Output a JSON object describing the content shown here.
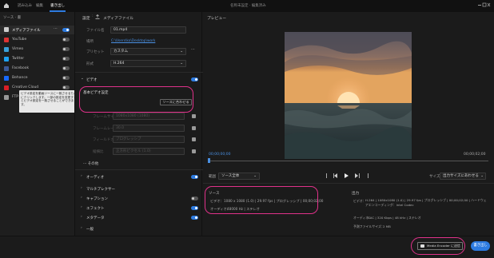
{
  "topbar": {
    "tabs": [
      "読み込み",
      "編集",
      "書き出し"
    ],
    "active_tab": 2,
    "title": "名称未設定 · 編集済み"
  },
  "sidebar": {
    "header": "ソース · 書",
    "items": [
      {
        "label": "メディアファイル",
        "on": true,
        "active": true
      },
      {
        "label": "YouTube",
        "on": false
      },
      {
        "label": "Vimeo",
        "on": false
      },
      {
        "label": "Twitter",
        "on": false
      },
      {
        "label": "Facebook",
        "on": false
      },
      {
        "label": "Behance",
        "on": false
      },
      {
        "label": "Creative Cloud",
        "on": false
      },
      {
        "label": "FTP",
        "on": false
      }
    ],
    "tooltip": "ビデオ設定を動画ソースに一致させるためにクリックします。一部の設定を変更するとビデオ設定を一致させることができます。"
  },
  "settings": {
    "header_left": "設定",
    "header_right": "メディアファイル",
    "filename_label": "ファイル名",
    "filename_value": "01.mp4",
    "location_label": "場所",
    "location_value": "C:\\Users\\ko\\Desktop\\work",
    "preset_label": "プリセット",
    "preset_value": "カスタム",
    "format_label": "形式",
    "format_value": "H.264",
    "video_section": "ビデオ",
    "basic_video": "基本ビデオ設定",
    "match_source": "ソースに合わせる",
    "rows": [
      {
        "label": "フレームサイズ",
        "value": "1080x1080 (1080)"
      },
      {
        "label": "フレームレート",
        "value": "30.0"
      },
      {
        "label": "フィールドオーダー",
        "value": "プログレッシブ"
      },
      {
        "label": "縦横比",
        "value": "正方形ピクセル (1.0)"
      }
    ],
    "more": "··· その他",
    "sections": [
      {
        "label": "オーディオ",
        "on": true
      },
      {
        "label": "マルチプレクサー",
        "on": false
      },
      {
        "label": "キャプション",
        "on": false
      },
      {
        "label": "エフェクト",
        "on": true
      },
      {
        "label": "メタデータ",
        "on": true
      },
      {
        "label": "一般",
        "on": false
      }
    ]
  },
  "preview": {
    "title": "プレビュー",
    "time_start": "00;00;00;00",
    "time_end": "00;00;02;00",
    "range_label": "範囲",
    "range_value": "ソース全体",
    "size_label": "サイズ",
    "size_value": "出力サイズにあわせる"
  },
  "source_info": {
    "heading": "ソース",
    "video_label": "ビデオ：",
    "video_value": "1080 x 1080 (1.0) | 29.97 fps | プログレッシブ | 00;00;02;00",
    "audio_label": "オーディオ：",
    "audio_value": "48000 Hz | ステレオ"
  },
  "output_info": {
    "heading": "出力",
    "video_label": "ビデオ：",
    "video_value": "H.264 | 1080x1080 (1.0) | 29.97 fps | プログレッシブ | 00;00;02;00 | ハードウェアエンコーディング：Intel Codec",
    "audio_label": "オーディオ：",
    "audio_value": "AAC | 320 Kbps | 48 kHz | ステレオ",
    "size_label": "予測ファイルサイズ：",
    "size_value": "2 MB"
  },
  "footer": {
    "media_encoder": "Media Encoder に送信",
    "export": "書き出し"
  },
  "colors": {
    "accent": "#2d7be0",
    "highlight": "#e0318a"
  }
}
